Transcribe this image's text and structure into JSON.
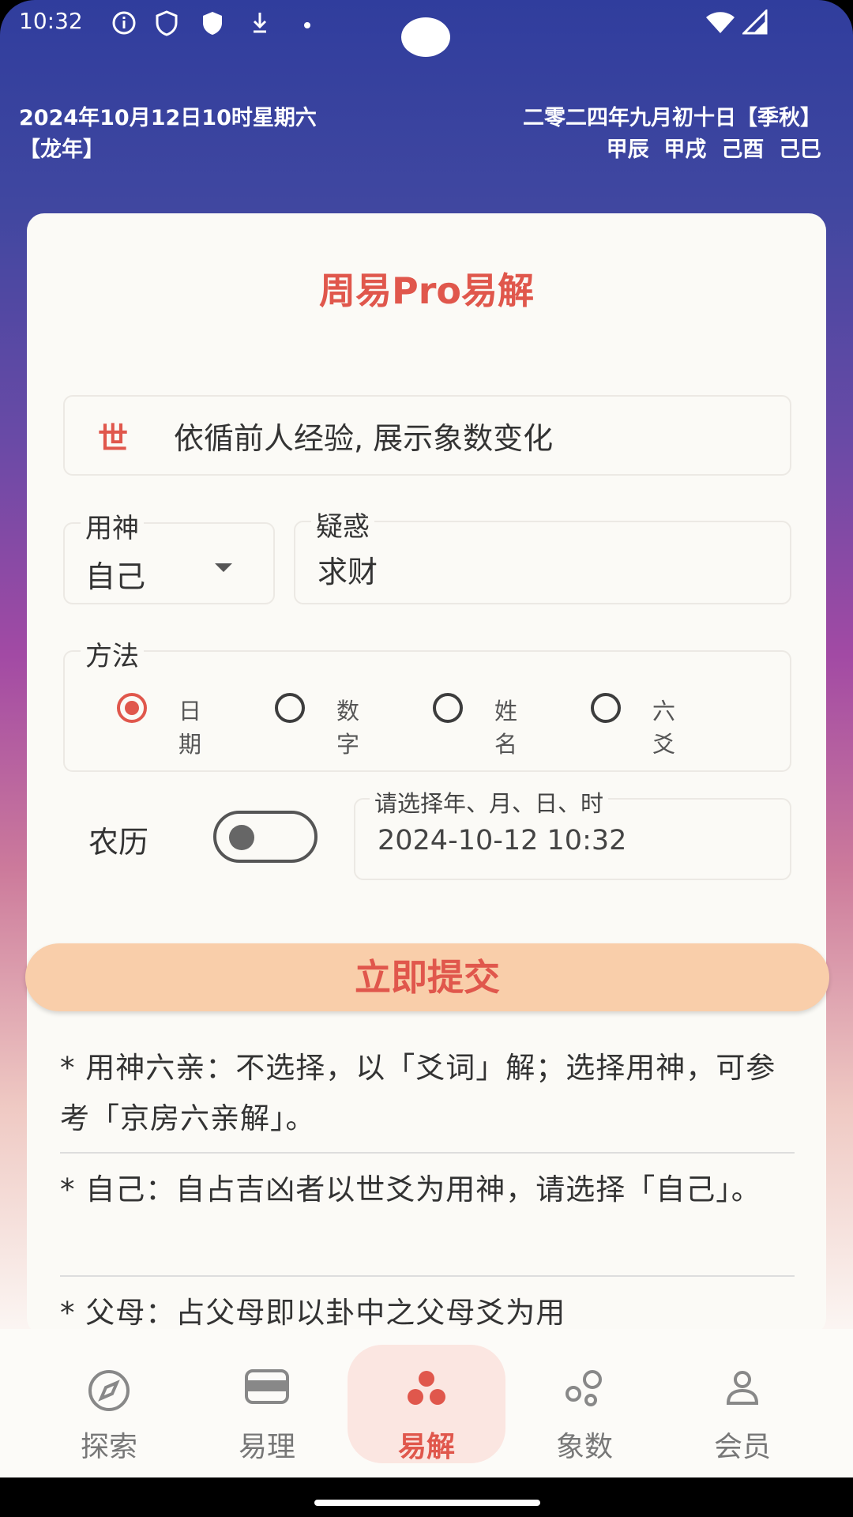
{
  "status_bar": {
    "time": "10:32"
  },
  "header": {
    "date_line": "2024年10月12日10时星期六",
    "year_tag": "【龙年】",
    "lunar_line": "二零二四年九月初十日【季秋】",
    "ganzhi": "甲辰  甲戌  己酉  己巳"
  },
  "card": {
    "title": "周易Pro易解",
    "shi_char": "世",
    "shi_text": "依循前人经验, 展示象数变化",
    "yongshen": {
      "label": "用神",
      "value": "自己"
    },
    "yihuo": {
      "label": "疑惑",
      "value": "求财"
    },
    "method": {
      "label": "方法",
      "options": [
        "日期",
        "数字",
        "姓名",
        "六爻"
      ],
      "selected": "日期"
    },
    "lunar": {
      "label": "农历",
      "on": false
    },
    "datetime": {
      "label": "请选择年、月、日、时",
      "value": "2024-10-12 10:32"
    },
    "submit_label": "立即提交",
    "notes": [
      "* 用神六亲：不选择，以「爻词」解；选择用神，可参考「京房六亲解」。",
      "* 自己：自占吉凶者以世爻为用神，请选择「自己」。",
      "* 父母：占父母即以卦中之父母爻为用"
    ]
  },
  "nav": {
    "items": [
      {
        "label": "探索",
        "icon": "compass-icon"
      },
      {
        "label": "易理",
        "icon": "card-icon"
      },
      {
        "label": "易解",
        "icon": "dots-cluster-icon",
        "active": true
      },
      {
        "label": "象数",
        "icon": "circles-icon"
      },
      {
        "label": "会员",
        "icon": "person-icon"
      }
    ]
  },
  "colors": {
    "accent": "#e0574c",
    "submit_bg": "#f9ceaa",
    "header_top": "#303d9d"
  }
}
